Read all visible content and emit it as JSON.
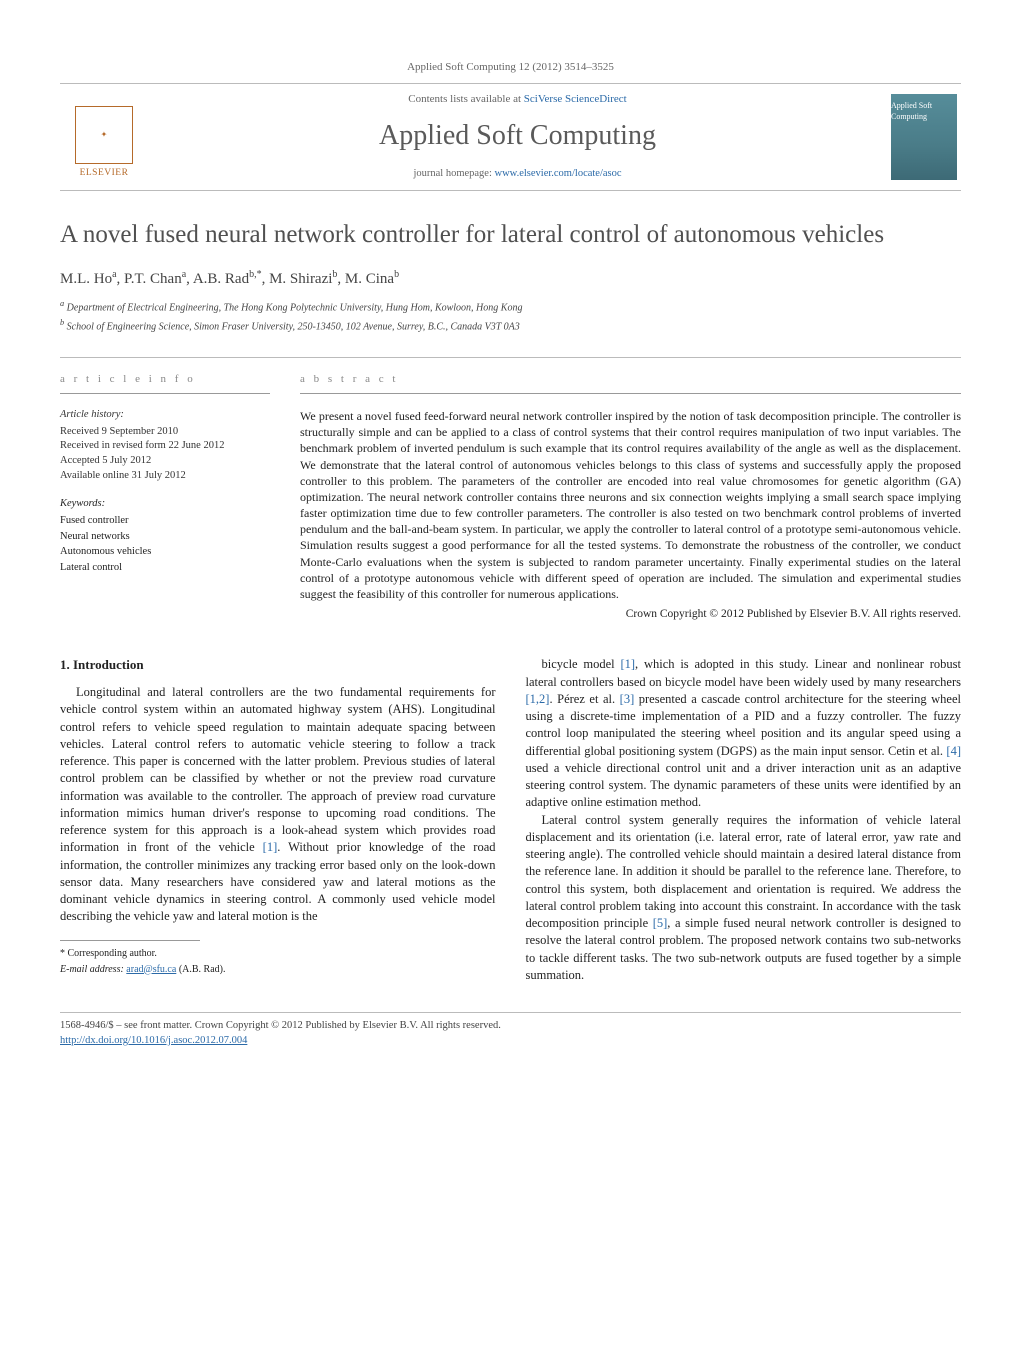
{
  "header": {
    "citation": "Applied Soft Computing 12 (2012) 3514–3525",
    "publisher_logo": "ELSEVIER",
    "contents_prefix": "Contents lists available at ",
    "contents_link": "SciVerse ScienceDirect",
    "journal": "Applied Soft Computing",
    "homepage_prefix": "journal homepage: ",
    "homepage_link": "www.elsevier.com/locate/asoc",
    "cover_text": "Applied Soft Computing"
  },
  "article": {
    "title": "A novel fused neural network controller for lateral control of autonomous vehicles",
    "authors_html": "M.L. Ho<sup>a</sup>, P.T. Chan<sup>a</sup>, A.B. Rad<sup>b,*</sup>, M. Shirazi<sup>b</sup>, M. Cina<sup>b</sup>",
    "affiliations": {
      "a": "Department of Electrical Engineering, The Hong Kong Polytechnic University, Hung Hom, Kowloon, Hong Kong",
      "b": "School of Engineering Science, Simon Fraser University, 250-13450, 102 Avenue, Surrey, B.C., Canada V3T 0A3"
    }
  },
  "info": {
    "heading": "a r t i c l e   i n f o",
    "history_label": "Article history:",
    "history": {
      "received": "Received 9 September 2010",
      "revised": "Received in revised form 22 June 2012",
      "accepted": "Accepted 5 July 2012",
      "online": "Available online 31 July 2012"
    },
    "keywords_label": "Keywords:",
    "keywords": [
      "Fused controller",
      "Neural networks",
      "Autonomous vehicles",
      "Lateral control"
    ]
  },
  "abstract": {
    "heading": "a b s t r a c t",
    "text": "We present a novel fused feed-forward neural network controller inspired by the notion of task decomposition principle. The controller is structurally simple and can be applied to a class of control systems that their control requires manipulation of two input variables. The benchmark problem of inverted pendulum is such example that its control requires availability of the angle as well as the displacement. We demonstrate that the lateral control of autonomous vehicles belongs to this class of systems and successfully apply the proposed controller to this problem. The parameters of the controller are encoded into real value chromosomes for genetic algorithm (GA) optimization. The neural network controller contains three neurons and six connection weights implying a small search space implying faster optimization time due to few controller parameters. The controller is also tested on two benchmark control problems of inverted pendulum and the ball-and-beam system. In particular, we apply the controller to lateral control of a prototype semi-autonomous vehicle. Simulation results suggest a good performance for all the tested systems. To demonstrate the robustness of the controller, we conduct Monte-Carlo evaluations when the system is subjected to random parameter uncertainty. Finally experimental studies on the lateral control of a prototype autonomous vehicle with different speed of operation are included. The simulation and experimental studies suggest the feasibility of this controller for numerous applications.",
    "copyright": "Crown Copyright © 2012 Published by Elsevier B.V. All rights reserved."
  },
  "body": {
    "section1_title": "1. Introduction",
    "p1": "Longitudinal and lateral controllers are the two fundamental requirements for vehicle control system within an automated highway system (AHS). Longitudinal control refers to vehicle speed regulation to maintain adequate spacing between vehicles. Lateral control refers to automatic vehicle steering to follow a track reference. This paper is concerned with the latter problem. Previous studies of lateral control problem can be classified by whether or not the preview road curvature information was available to the controller. The approach of preview road curvature information mimics human driver's response to upcoming road conditions. The reference system for this approach is a look-ahead system which provides road information in front of the vehicle [1]. Without prior knowledge of the road information, the controller minimizes any tracking error based only on the look-down sensor data. Many researchers have considered yaw and lateral motions as the dominant vehicle dynamics in steering control. A commonly used vehicle model describing the vehicle yaw and lateral motion is the",
    "p2": "bicycle model [1], which is adopted in this study. Linear and nonlinear robust lateral controllers based on bicycle model have been widely used by many researchers [1,2]. Pérez et al. [3] presented a cascade control architecture for the steering wheel using a discrete-time implementation of a PID and a fuzzy controller. The fuzzy control loop manipulated the steering wheel position and its angular speed using a differential global positioning system (DGPS) as the main input sensor. Cetin et al. [4] used a vehicle directional control unit and a driver interaction unit as an adaptive steering control system. The dynamic parameters of these units were identified by an adaptive online estimation method.",
    "p3": "Lateral control system generally requires the information of vehicle lateral displacement and its orientation (i.e. lateral error, rate of lateral error, yaw rate and steering angle). The controlled vehicle should maintain a desired lateral distance from the reference lane. In addition it should be parallel to the reference lane. Therefore, to control this system, both displacement and orientation is required. We address the lateral control problem taking into account this constraint. In accordance with the task decomposition principle [5], a simple fused neural network controller is designed to resolve the lateral control problem. The proposed network contains two sub-networks to tackle different tasks. The two sub-network outputs are fused together by a simple summation."
  },
  "footnotes": {
    "corr": "* Corresponding author.",
    "email_label": "E-mail address: ",
    "email": "arad@sfu.ca",
    "email_suffix": " (A.B. Rad)."
  },
  "bottom": {
    "line1": "1568-4946/$ – see front matter. Crown Copyright © 2012 Published by Elsevier B.V. All rights reserved.",
    "doi_url": "http://dx.doi.org/10.1016/j.asoc.2012.07.004"
  }
}
